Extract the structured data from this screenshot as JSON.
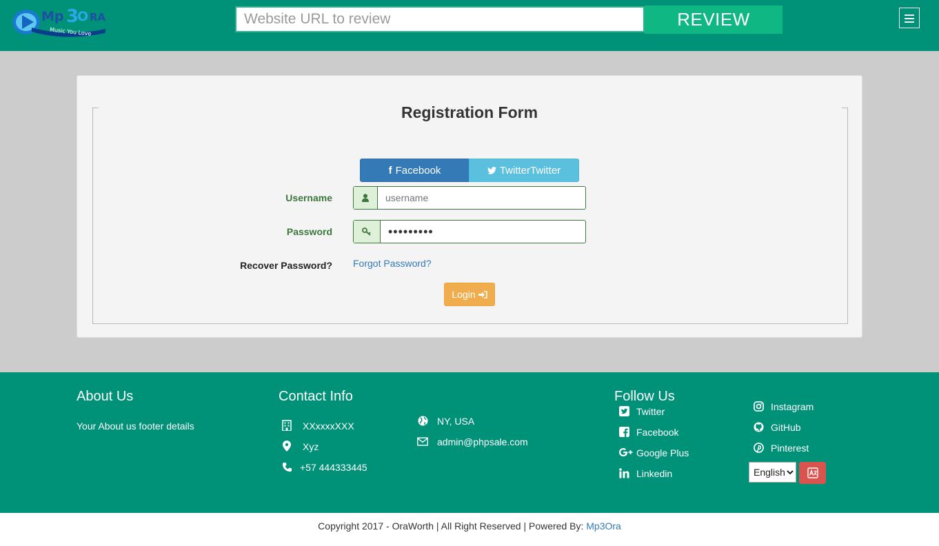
{
  "header": {
    "logo_text": "Mp3Ora",
    "logo_tagline": "Music You Love",
    "url_placeholder": "Website URL to review",
    "review_label": "REVIEW",
    "menu_icon": "hamburger-menu-icon",
    "colors": {
      "bar": "#009179",
      "review_button": "#0fb882"
    }
  },
  "form": {
    "title": "Registration Form",
    "facebook_label": "Facebook",
    "twitter_label": "TwitterTwitter",
    "username_label": "Username",
    "username_placeholder": "username",
    "password_label": "Password",
    "password_value": "•••••••••",
    "recover_label": "Recover Password?",
    "forgot_link": "Forgot Password?",
    "login_label": "Login",
    "colors": {
      "facebook": "#337ab7",
      "twitter": "#5bc0de",
      "login": "#f0ad4e",
      "valid": "#3c763d"
    }
  },
  "footer": {
    "about_title": "About Us",
    "about_text": "Your About us footer details",
    "contact_title": "Contact Info",
    "contact_items": [
      {
        "icon": "building-icon",
        "text": "XXxxxxXXX"
      },
      {
        "icon": "map-marker-icon",
        "text": "Xyz"
      },
      {
        "icon": "phone-icon",
        "text": "+57 444333445"
      },
      {
        "icon": "globe-icon",
        "text": "NY, USA"
      },
      {
        "icon": "envelope-icon",
        "text": "admin@phpsale.com"
      }
    ],
    "follow_title": "Follow Us",
    "social_links": [
      {
        "icon": "twitter-icon",
        "text": "Twitter"
      },
      {
        "icon": "facebook-icon",
        "text": "Facebook"
      },
      {
        "icon": "google-plus-icon",
        "text": "Google Plus"
      },
      {
        "icon": "linkedin-icon",
        "text": "Linkedin"
      },
      {
        "icon": "instagram-icon",
        "text": "Instagram"
      },
      {
        "icon": "github-icon",
        "text": "GitHub"
      },
      {
        "icon": "pinterest-icon",
        "text": "Pinterest"
      }
    ],
    "language_selected": "English",
    "translate_icon": "translate-icon"
  },
  "copyright": {
    "text": "Copyright 2017 - OraWorth | All Right Reserved | Powered By: ",
    "link": "Mp3Ora"
  }
}
